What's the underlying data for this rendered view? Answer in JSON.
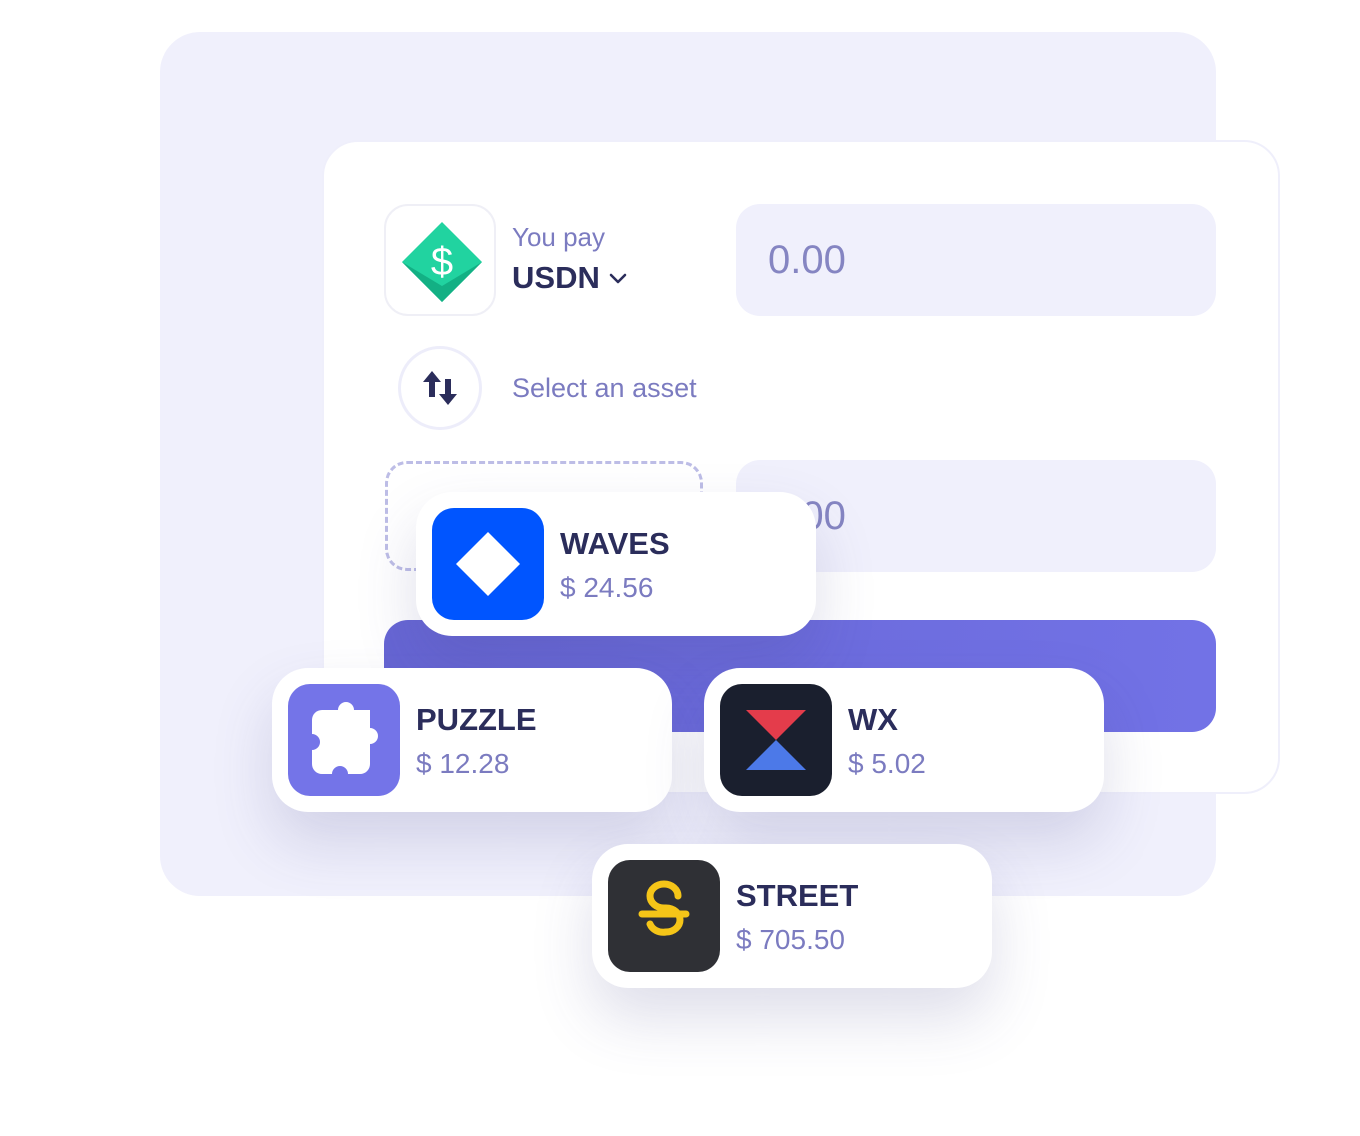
{
  "swap": {
    "pay_label": "You pay",
    "pay_asset": "USDN",
    "pay_amount": "0.00",
    "select_label": "Select an asset",
    "receive_amount": "0.00"
  },
  "icons": {
    "pay_asset_icon": "usdn-logo-icon",
    "dropdown": "chevron-down-icon",
    "swap": "swap-arrows-icon"
  },
  "tokens": [
    {
      "name": "WAVES",
      "price": "$ 24.56",
      "icon": "waves-logo-icon",
      "color": "#0055ff"
    },
    {
      "name": "PUZZLE",
      "price": "$ 12.28",
      "icon": "puzzle-logo-icon",
      "color": "#7474e8"
    },
    {
      "name": "WX",
      "price": "$ 5.02",
      "icon": "wx-logo-icon",
      "color": "#1a1f2e"
    },
    {
      "name": "STREET",
      "price": "$ 705.50",
      "icon": "street-logo-icon",
      "color": "#2f3035"
    }
  ],
  "colors": {
    "accent": "#7272e6",
    "panel": "#f0f0fc",
    "title": "#2b2d5b",
    "muted": "#7b7bc0"
  }
}
